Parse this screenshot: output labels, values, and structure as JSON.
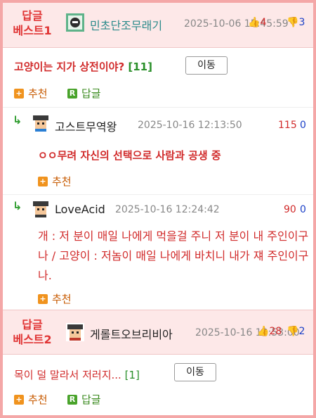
{
  "best1": {
    "label_line1": "답글",
    "label_line2": "베스트1",
    "nick": "민초단조무래기",
    "date": "2025-10-06 15:45:59",
    "up": "4",
    "down": "3",
    "title": "고양이는 지가 상전이야?",
    "count": "[11]",
    "move": "이동",
    "recommend": "추천",
    "reply": "답글"
  },
  "reply1": {
    "nick": "고스트무역왕",
    "date": "2025-10-16 12:13:50",
    "up": "115",
    "down": "0",
    "text": "ㅇㅇ무려 자신의 선택으로 사람과 공생 중",
    "recommend": "추천"
  },
  "reply2": {
    "nick": "LoveAcid",
    "date": "2025-10-16 12:24:42",
    "up": "90",
    "down": "0",
    "text": "개 : 저 분이 매일 나에게 먹을걸 주니 저 분이 내 주인이구나 / 고양이 : 저놈이 매일 나에게 바치니 내가 쟤 주인이구나.",
    "recommend": "추천"
  },
  "best2": {
    "label_line1": "답글",
    "label_line2": "베스트2",
    "nick": "게롤트오브리비아",
    "date": "2025-10-16 12:53:00",
    "up": "28",
    "down": "2",
    "title": "목이 덜 말라서 저러지...",
    "count": "[1]",
    "move": "이동",
    "recommend": "추천",
    "reply": "답글"
  },
  "icons": {
    "thumb_up": "thumb-up-icon",
    "thumb_down": "thumb-down-icon",
    "plus": "plus-square-icon",
    "reply_badge": "r-square-icon",
    "reply_arrow": "reply-arrow-icon"
  },
  "colors": {
    "accent_red": "#d12b2b",
    "header_bg": "#fde8e8",
    "border_pink": "#f4a7a7",
    "recommend_orange": "#f0931e",
    "reply_green": "#49a32b",
    "down_blue": "#1a3fc7"
  }
}
